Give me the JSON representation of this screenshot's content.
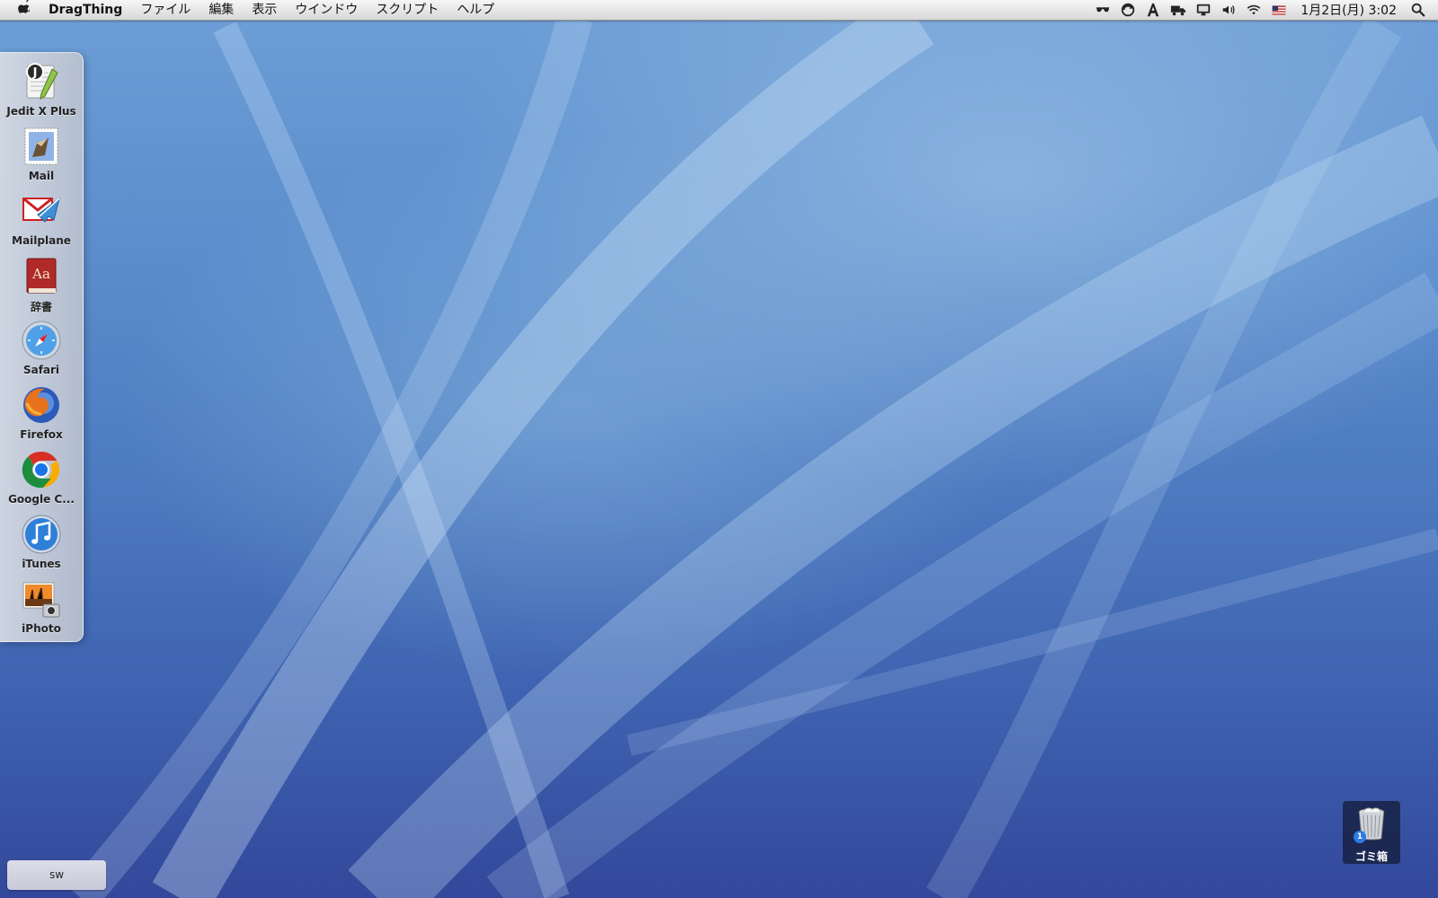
{
  "menubar": {
    "apple": "",
    "app_name": "DragThing",
    "menus": [
      "ファイル",
      "編集",
      "表示",
      "ウインドウ",
      "スクリプト",
      "ヘルプ"
    ],
    "clock": "1月2日(月) 3:02",
    "status_icons": [
      "sunglasses-icon",
      "sync-icon",
      "font-icon",
      "truck-icon",
      "display-icon",
      "volume-icon",
      "wifi-icon",
      "us-flag-icon",
      "spotlight-icon"
    ]
  },
  "dock": {
    "items": [
      {
        "label": "Jedit X Plus",
        "icon": "jedit-icon"
      },
      {
        "label": "Mail",
        "icon": "mail-icon"
      },
      {
        "label": "Mailplane",
        "icon": "mailplane-icon"
      },
      {
        "label": "辞書",
        "icon": "dictionary-icon"
      },
      {
        "label": "Safari",
        "icon": "safari-icon"
      },
      {
        "label": "Firefox",
        "icon": "firefox-icon"
      },
      {
        "label": "Google C...",
        "icon": "chrome-icon"
      },
      {
        "label": "iTunes",
        "icon": "itunes-icon"
      },
      {
        "label": "iPhoto",
        "icon": "iphoto-icon"
      }
    ]
  },
  "trash": {
    "label": "ゴミ箱",
    "badge": "1"
  },
  "sw_button": {
    "label": "sw"
  }
}
